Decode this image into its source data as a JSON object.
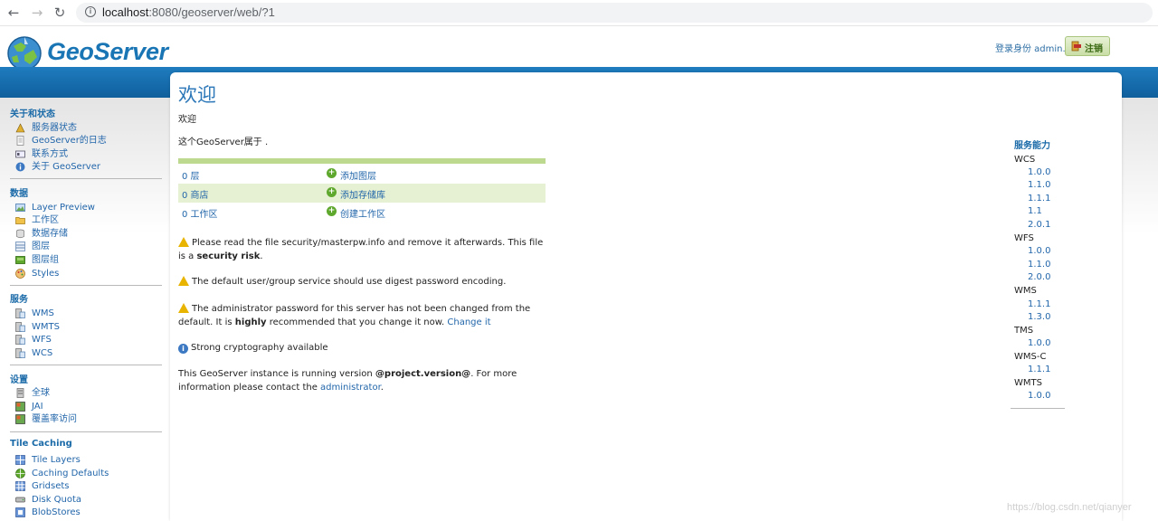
{
  "browser": {
    "url_host": "localhost",
    "url_path": ":8080/geoserver/web/?1"
  },
  "header": {
    "logo_text": "GeoServer",
    "login_status": "登录身份 admin.",
    "logout_label": "注销"
  },
  "sidebar": {
    "sections": [
      {
        "title": "关于和状态",
        "items": [
          "服务器状态",
          "GeoServer的日志",
          "联系方式",
          "关于 GeoServer"
        ]
      },
      {
        "title": "数据",
        "items": [
          "Layer Preview",
          "工作区",
          "数据存储",
          "图层",
          "图层组",
          "Styles"
        ]
      },
      {
        "title": "服务",
        "items": [
          "WMS",
          "WMTS",
          "WFS",
          "WCS"
        ]
      },
      {
        "title": "设置",
        "items": [
          "全球",
          "JAI",
          "覆盖率访问"
        ]
      },
      {
        "title": "Tile Caching",
        "items": [
          "Tile Layers",
          "Caching Defaults",
          "Gridsets",
          "Disk Quota",
          "BlobStores"
        ]
      }
    ]
  },
  "main": {
    "title": "欢迎",
    "subtitle": "欢迎",
    "description": "这个GeoServer属于 .",
    "stats": [
      {
        "count": "0 层",
        "action": "添加图层"
      },
      {
        "count": "0 商店",
        "action": "添加存储库"
      },
      {
        "count": "0 工作区",
        "action": "创建工作区"
      }
    ],
    "messages": {
      "m1_text": "Please read the file security/masterpw.info and remove it afterwards. This file is a",
      "m1_bold": "security risk",
      "m1_end": ".",
      "m2_text": "The default user/group service should use digest password encoding.",
      "m3_text": "The administrator password for this server has not been changed from the default. It is",
      "m3_bold": "highly",
      "m3_rest": "recommended that you change it now.",
      "m3_link": "Change it",
      "m4_text": "Strong cryptography available",
      "m5_pre": "This GeoServer instance is running version",
      "m5_bold": "@project.version@",
      "m5_post": ". For more information please contact the",
      "m5_link": "administrator",
      "m5_end": "."
    }
  },
  "capabilities": {
    "title": "服务能力",
    "services": [
      {
        "name": "WCS",
        "versions": [
          "1.0.0",
          "1.1.0",
          "1.1.1",
          "1.1",
          "2.0.1"
        ]
      },
      {
        "name": "WFS",
        "versions": [
          "1.0.0",
          "1.1.0",
          "2.0.0"
        ]
      },
      {
        "name": "WMS",
        "versions": [
          "1.1.1",
          "1.3.0"
        ]
      },
      {
        "name": "TMS",
        "versions": [
          "1.0.0"
        ]
      },
      {
        "name": "WMS-C",
        "versions": [
          "1.1.1"
        ]
      },
      {
        "name": "WMTS",
        "versions": [
          "1.0.0"
        ]
      }
    ]
  },
  "watermark": "https://blog.csdn.net/qianyer"
}
